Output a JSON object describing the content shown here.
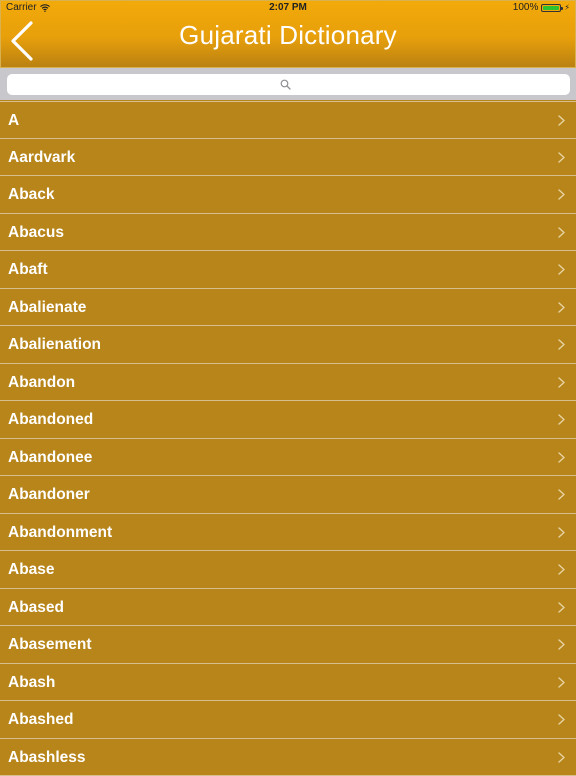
{
  "status_bar": {
    "carrier": "Carrier",
    "time": "2:07 PM",
    "battery": "100%",
    "wifi_icon": "wifi-icon",
    "battery_icon": "battery-icon",
    "battery_fill_fraction": 1.0,
    "charge_icon": "charging-bolt-icon"
  },
  "nav": {
    "title": "Gujarati Dictionary",
    "back_icon": "chevron-left-icon"
  },
  "search": {
    "value": "",
    "placeholder": "",
    "icon": "search-icon"
  },
  "list": {
    "chevron_icon": "chevron-right-icon",
    "items": [
      "A",
      "Aardvark",
      "Aback",
      "Abacus",
      "Abaft",
      "Abalienate",
      "Abalienation",
      "Abandon",
      "Abandoned",
      "Abandonee",
      "Abandoner",
      "Abandonment",
      "Abase",
      "Abased",
      "Abasement",
      "Abash",
      "Abashed",
      "Abashless"
    ]
  },
  "colors": {
    "header_top": "#f3aa0a",
    "header_bottom": "#b98112",
    "list_background": "#b78519",
    "separator": "#d7be8c",
    "text": "#ffffff",
    "battery": "#2fc22f"
  }
}
